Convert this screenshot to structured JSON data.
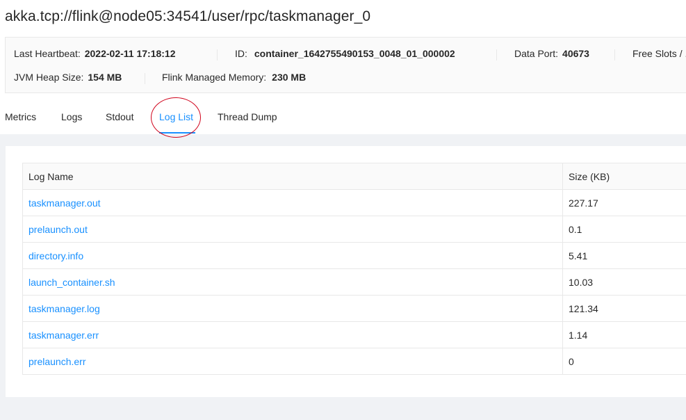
{
  "header": {
    "title": "akka.tcp://flink@node05:34541/user/rpc/taskmanager_0"
  },
  "details": {
    "last_heartbeat_label": "Last Heartbeat:",
    "last_heartbeat_value": "2022-02-11 17:18:12",
    "id_label": "ID:",
    "id_value": "container_1642755490153_0048_01_000002",
    "data_port_label": "Data Port:",
    "data_port_value": "40673",
    "free_slots_label": "Free Slots / ...",
    "jvm_heap_label": "JVM Heap Size:",
    "jvm_heap_value": "154 MB",
    "managed_memory_label": "Flink Managed Memory:",
    "managed_memory_value": "230 MB"
  },
  "tabs": [
    {
      "label": "Metrics"
    },
    {
      "label": "Logs"
    },
    {
      "label": "Stdout"
    },
    {
      "label": "Log List"
    },
    {
      "label": "Thread Dump"
    }
  ],
  "active_tab": "Log List",
  "table": {
    "columns": [
      "Log Name",
      "Size (KB)"
    ],
    "rows": [
      {
        "name": "taskmanager.out",
        "size": "227.17"
      },
      {
        "name": "prelaunch.out",
        "size": "0.1"
      },
      {
        "name": "directory.info",
        "size": "5.41"
      },
      {
        "name": "launch_container.sh",
        "size": "10.03"
      },
      {
        "name": "taskmanager.log",
        "size": "121.34"
      },
      {
        "name": "taskmanager.err",
        "size": "1.14"
      },
      {
        "name": "prelaunch.err",
        "size": "0"
      }
    ]
  },
  "colors": {
    "accent": "#1890ff",
    "annotation": "#d0021b",
    "page_bg": "#f0f2f5"
  }
}
